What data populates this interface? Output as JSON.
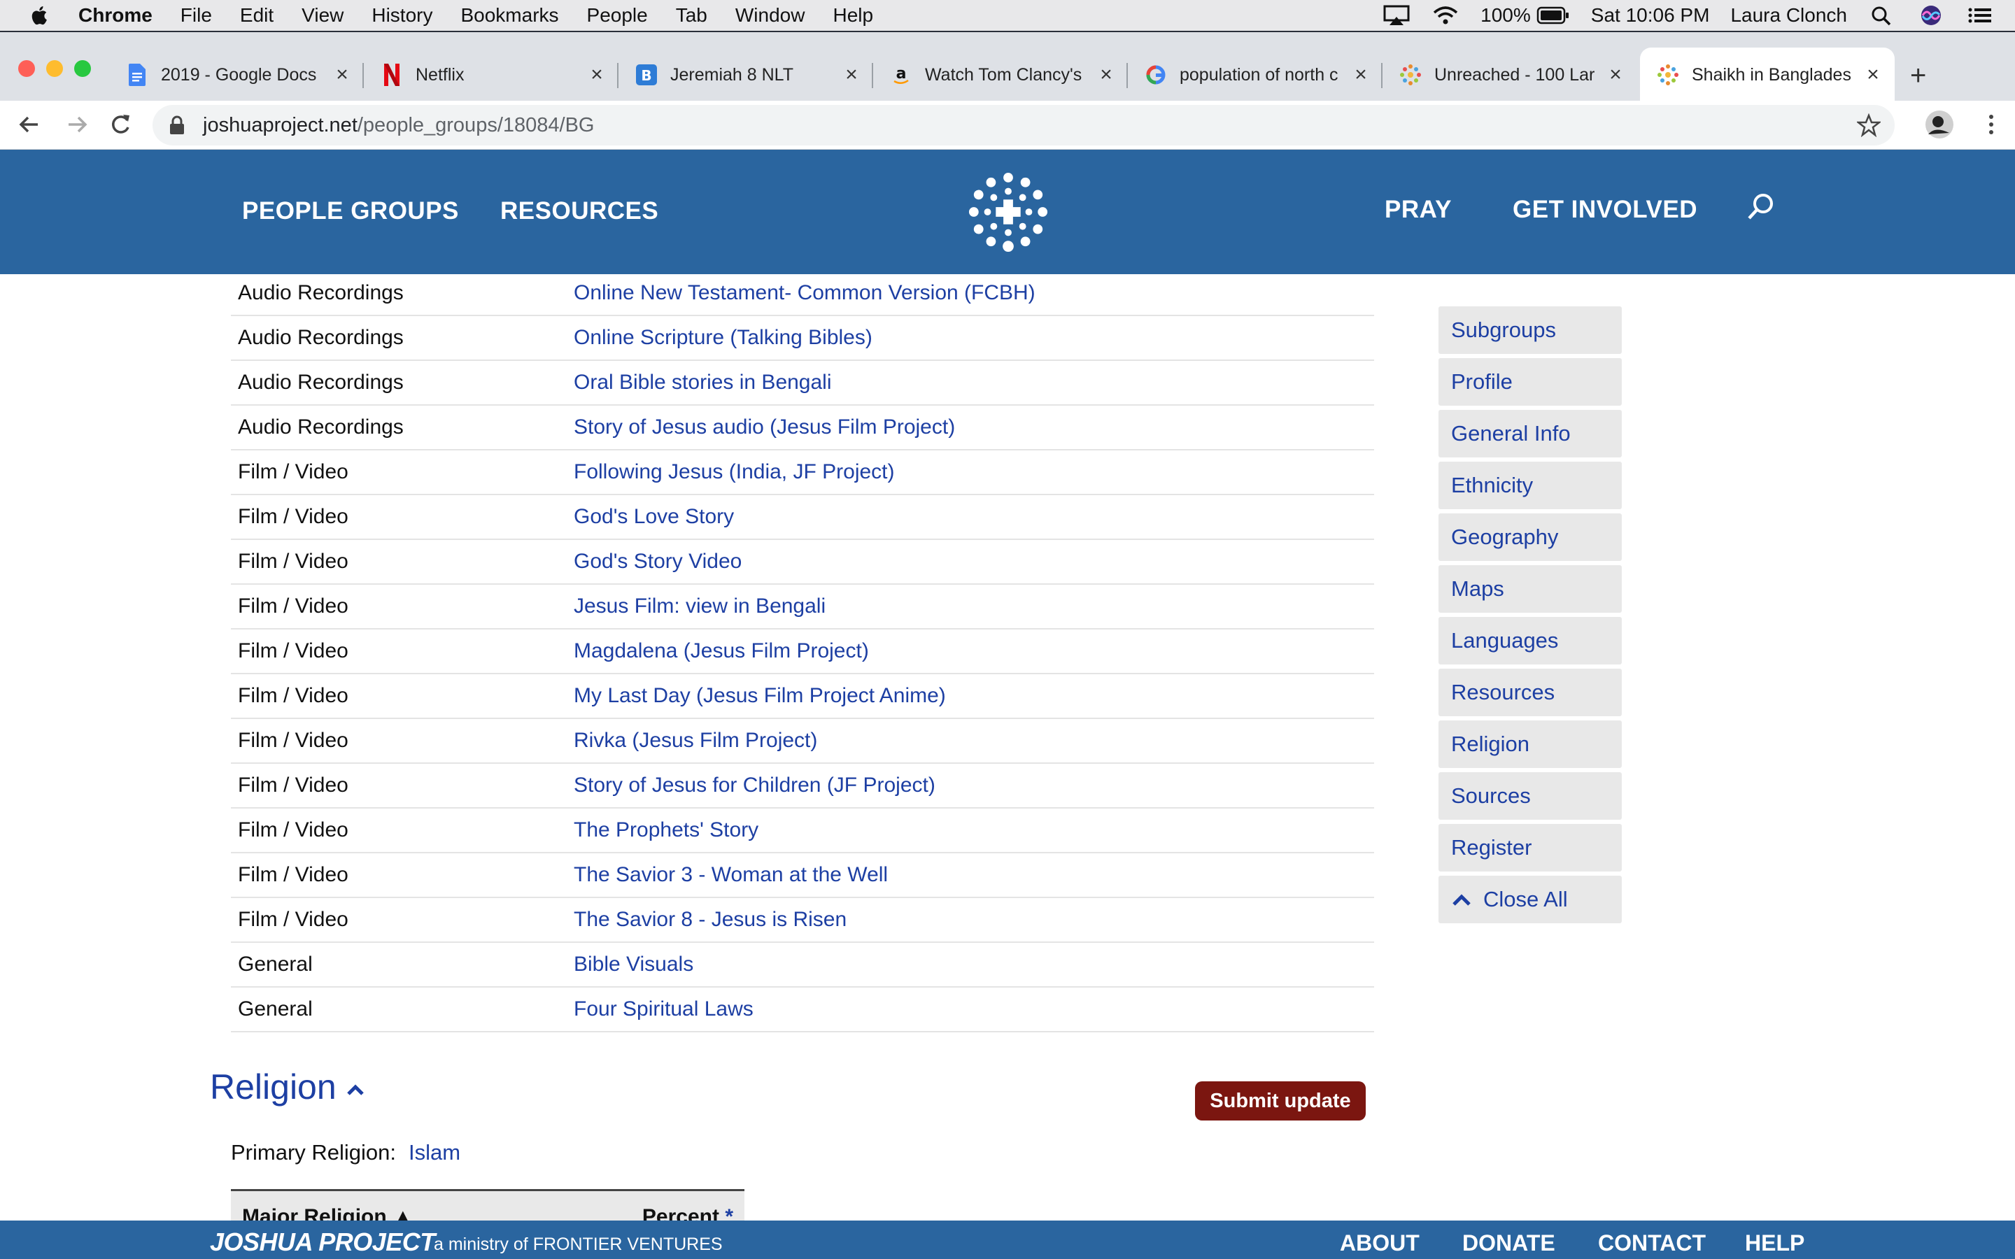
{
  "menubar": {
    "app_name": "Chrome",
    "items": [
      "File",
      "Edit",
      "View",
      "History",
      "Bookmarks",
      "People",
      "Tab",
      "Window",
      "Help"
    ],
    "battery": "100%",
    "clock": "Sat 10:06 PM",
    "user": "Laura Clonch"
  },
  "tabs": [
    {
      "title": "2019 - Google Docs",
      "icon": "google-docs-icon"
    },
    {
      "title": "Netflix",
      "icon": "netflix-icon"
    },
    {
      "title": "Jeremiah 8 NLT",
      "icon": "bible-gateway-icon"
    },
    {
      "title": "Watch Tom Clancy's",
      "icon": "amazon-icon"
    },
    {
      "title": "population of north c",
      "icon": "google-icon"
    },
    {
      "title": "Unreached - 100 Lar",
      "icon": "joshua-project-icon"
    },
    {
      "title": "Shaikh in Banglades",
      "icon": "joshua-project-icon"
    }
  ],
  "url": {
    "host": "joshuaproject.net",
    "path": "/people_groups/18084/BG"
  },
  "site_nav": {
    "people_groups": "PEOPLE GROUPS",
    "resources": "RESOURCES",
    "pray": "PRAY",
    "get_involved": "GET INVOLVED"
  },
  "resources_rows": [
    {
      "category": "Audio Recordings",
      "title": "Online New Testament- Common Version (FCBH)"
    },
    {
      "category": "Audio Recordings",
      "title": "Online Scripture (Talking Bibles)"
    },
    {
      "category": "Audio Recordings",
      "title": "Oral Bible stories in Bengali"
    },
    {
      "category": "Audio Recordings",
      "title": "Story of Jesus audio (Jesus Film Project)"
    },
    {
      "category": "Film / Video",
      "title": "Following Jesus (India, JF Project)"
    },
    {
      "category": "Film / Video",
      "title": "God's Love Story"
    },
    {
      "category": "Film / Video",
      "title": "God's Story Video"
    },
    {
      "category": "Film / Video",
      "title": "Jesus Film: view in Bengali"
    },
    {
      "category": "Film / Video",
      "title": "Magdalena (Jesus Film Project)"
    },
    {
      "category": "Film / Video",
      "title": "My Last Day (Jesus Film Project Anime)"
    },
    {
      "category": "Film / Video",
      "title": "Rivka (Jesus Film Project)"
    },
    {
      "category": "Film / Video",
      "title": "Story of Jesus for Children (JF Project)"
    },
    {
      "category": "Film / Video",
      "title": "The Prophets' Story"
    },
    {
      "category": "Film / Video",
      "title": "The Savior 3 - Woman at the Well"
    },
    {
      "category": "Film / Video",
      "title": "The Savior 8 - Jesus is Risen"
    },
    {
      "category": "General",
      "title": "Bible Visuals"
    },
    {
      "category": "General",
      "title": "Four Spiritual Laws"
    }
  ],
  "side_nav": [
    "Subgroups",
    "Profile",
    "General Info",
    "Ethnicity",
    "Geography",
    "Maps",
    "Languages",
    "Resources",
    "Religion",
    "Sources",
    "Register"
  ],
  "side_nav_close": "Close All",
  "religion": {
    "heading": "Religion",
    "submit_label": "Submit update",
    "primary_label": "Primary Religion:",
    "primary_value": "Islam",
    "col_major": "Major Religion ▲",
    "col_percent": "Percent",
    "col_percent_mark": "*"
  },
  "footer": {
    "brand": "JOSHUA PROJECT",
    "ministry": "a ministry of FRONTIER VENTURES",
    "links": [
      "ABOUT",
      "DONATE",
      "CONTACT",
      "HELP"
    ]
  },
  "colors": {
    "site_blue": "#2a659f",
    "link_blue": "#1d3fa3",
    "submit_red": "#7b1610"
  }
}
